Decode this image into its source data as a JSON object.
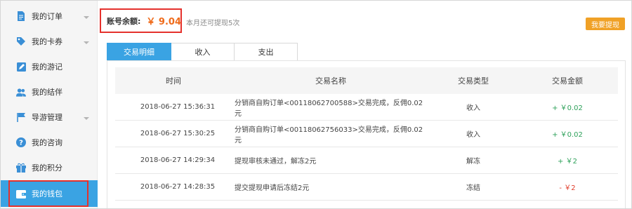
{
  "sidebar": {
    "items": [
      {
        "label": "我的订单",
        "icon": "document-icon",
        "has_arrow": true,
        "active": false
      },
      {
        "label": "我的卡券",
        "icon": "tag-icon",
        "has_arrow": true,
        "active": false
      },
      {
        "label": "我的游记",
        "icon": "edit-icon",
        "has_arrow": false,
        "active": false
      },
      {
        "label": "我的结伴",
        "icon": "users-icon",
        "has_arrow": false,
        "active": false
      },
      {
        "label": "导游管理",
        "icon": "flag-icon",
        "has_arrow": true,
        "active": false
      },
      {
        "label": "我的咨询",
        "icon": "question-icon",
        "has_arrow": false,
        "active": false
      },
      {
        "label": "我的积分",
        "icon": "gift-icon",
        "has_arrow": false,
        "active": false
      },
      {
        "label": "我的钱包",
        "icon": "wallet-icon",
        "has_arrow": false,
        "active": true
      }
    ]
  },
  "account": {
    "balance_label": "账号余额:",
    "balance_value": "￥ 9.04",
    "withdraw_note": "本月还可提现5次",
    "withdraw_button": "我要提现"
  },
  "tabs": [
    {
      "label": "交易明细",
      "active": true
    },
    {
      "label": "收入",
      "active": false
    },
    {
      "label": "支出",
      "active": false
    }
  ],
  "table": {
    "headers": [
      "时间",
      "交易名称",
      "交易类型",
      "交易金额"
    ],
    "rows": [
      {
        "time": "2018-06-27 15:36:31",
        "name": "分销商自购订单<00118062700588>交易完成，反佣0.02元",
        "type": "收入",
        "amount": "+ ￥0.02",
        "direction": "in"
      },
      {
        "time": "2018-06-27 15:30:25",
        "name": "分销商自购订单<00118062756033>交易完成，反佣0.02元",
        "type": "收入",
        "amount": "+ ￥0.02",
        "direction": "in"
      },
      {
        "time": "2018-06-27 14:29:34",
        "name": "提现审核未通过，解冻2元",
        "type": "解冻",
        "amount": "+ ￥2",
        "direction": "in"
      },
      {
        "time": "2018-06-27 14:28:35",
        "name": "提交提现申请后冻结2元",
        "type": "冻结",
        "amount": "- ￥2",
        "direction": "out"
      }
    ]
  },
  "colors": {
    "accent": "#3aa3e3",
    "balance": "#ef6b1b",
    "button": "#f0a126",
    "income": "#2ea15a",
    "expense": "#e03d2b",
    "highlight_box": "#e5312c"
  }
}
